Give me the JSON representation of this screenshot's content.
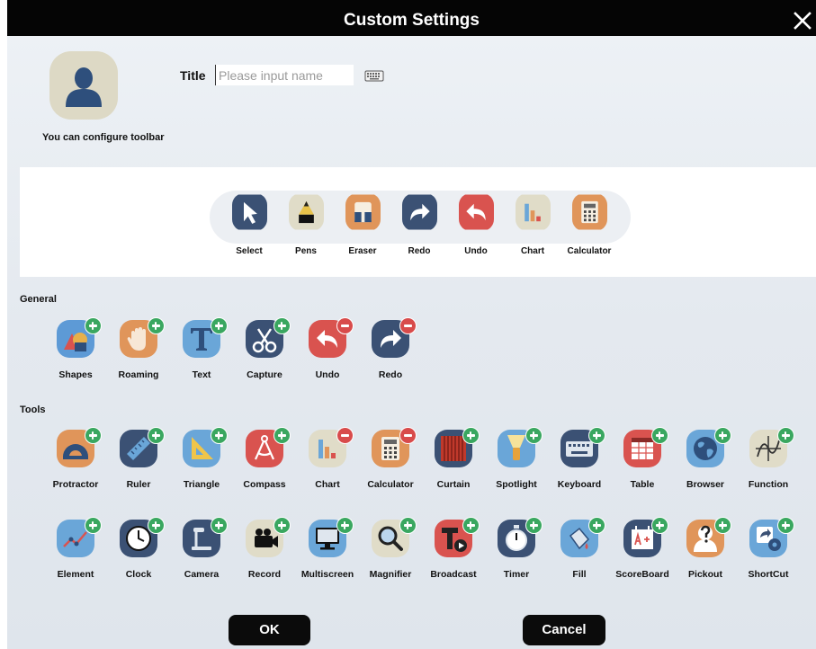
{
  "window": {
    "title": "Custom Settings"
  },
  "profile": {
    "configure_text": "You can configure toolbar"
  },
  "title_field": {
    "label": "Title",
    "placeholder": "Please input name",
    "value": ""
  },
  "preview_toolbar": [
    {
      "label": "Select",
      "icon": "cursor-arrow-icon",
      "color": "#3b5174"
    },
    {
      "label": "Pens",
      "icon": "pen-icon",
      "color": "#e0dcc8"
    },
    {
      "label": "Eraser",
      "icon": "eraser-icon",
      "color": "#e0955a"
    },
    {
      "label": "Redo",
      "icon": "redo-arrow-icon",
      "color": "#3b5174"
    },
    {
      "label": "Undo",
      "icon": "undo-arrow-icon",
      "color": "#d9534f"
    },
    {
      "label": "Chart",
      "icon": "bar-chart-icon",
      "color": "#e0dcc8"
    },
    {
      "label": "Calculator",
      "icon": "calculator-icon",
      "color": "#e0955a"
    }
  ],
  "sections": {
    "general": "General",
    "tools": "Tools"
  },
  "general_tools": [
    {
      "label": "Shapes",
      "icon": "shapes-icon",
      "color": "#5d9ad6",
      "badge": "add"
    },
    {
      "label": "Roaming",
      "icon": "hand-icon",
      "color": "#e0955a",
      "badge": "add"
    },
    {
      "label": "Text",
      "icon": "text-icon",
      "color": "#6aa6d8",
      "badge": "add"
    },
    {
      "label": "Capture",
      "icon": "scissors-icon",
      "color": "#3b5174",
      "badge": "add"
    },
    {
      "label": "Undo",
      "icon": "undo-arrow-icon",
      "color": "#d9534f",
      "badge": "remove"
    },
    {
      "label": "Redo",
      "icon": "redo-arrow-icon",
      "color": "#3b5174",
      "badge": "remove"
    }
  ],
  "tools_row1": [
    {
      "label": "Protractor",
      "icon": "protractor-icon",
      "color": "#e0955a",
      "badge": "add"
    },
    {
      "label": "Ruler",
      "icon": "ruler-icon",
      "color": "#3b5174",
      "badge": "add"
    },
    {
      "label": "Triangle",
      "icon": "triangle-ruler-icon",
      "color": "#6aa6d8",
      "badge": "add"
    },
    {
      "label": "Compass",
      "icon": "compass-icon",
      "color": "#d9534f",
      "badge": "add"
    },
    {
      "label": "Chart",
      "icon": "bar-chart-icon",
      "color": "#e0dcc8",
      "badge": "remove"
    },
    {
      "label": "Calculator",
      "icon": "calculator-icon",
      "color": "#e0955a",
      "badge": "remove"
    },
    {
      "label": "Curtain",
      "icon": "curtain-icon",
      "color": "#3b5174",
      "badge": "add"
    },
    {
      "label": "Spotlight",
      "icon": "spotlight-icon",
      "color": "#6aa6d8",
      "badge": "add"
    },
    {
      "label": "Keyboard",
      "icon": "keyboard-icon",
      "color": "#3b5174",
      "badge": "add"
    },
    {
      "label": "Table",
      "icon": "table-icon",
      "color": "#d9534f",
      "badge": "add"
    },
    {
      "label": "Browser",
      "icon": "globe-icon",
      "color": "#6aa6d8",
      "badge": "add"
    },
    {
      "label": "Function",
      "icon": "function-graph-icon",
      "color": "#e0dcc8",
      "badge": "add"
    }
  ],
  "tools_row2": [
    {
      "label": "Element",
      "icon": "element-chart-icon",
      "color": "#6aa6d8",
      "badge": "add"
    },
    {
      "label": "Clock",
      "icon": "clock-icon",
      "color": "#3b5174",
      "badge": "add"
    },
    {
      "label": "Camera",
      "icon": "document-camera-icon",
      "color": "#3b5174",
      "badge": "add"
    },
    {
      "label": "Record",
      "icon": "video-camera-icon",
      "color": "#e0dcc8",
      "badge": "add"
    },
    {
      "label": "Multiscreen",
      "icon": "monitor-icon",
      "color": "#6aa6d8",
      "badge": "add"
    },
    {
      "label": "Magnifier",
      "icon": "magnifier-icon",
      "color": "#e0dcc8",
      "badge": "add"
    },
    {
      "label": "Broadcast",
      "icon": "broadcast-icon",
      "color": "#d9534f",
      "badge": "add"
    },
    {
      "label": "Timer",
      "icon": "stopwatch-icon",
      "color": "#3b5174",
      "badge": "add"
    },
    {
      "label": "Fill",
      "icon": "paint-bucket-icon",
      "color": "#6aa6d8",
      "badge": "add"
    },
    {
      "label": "ScoreBoard",
      "icon": "scoreboard-icon",
      "color": "#3b5174",
      "badge": "add"
    },
    {
      "label": "Pickout",
      "icon": "question-person-icon",
      "color": "#e0955a",
      "badge": "add"
    },
    {
      "label": "ShortCut",
      "icon": "shortcut-gear-icon",
      "color": "#6aa6d8",
      "badge": "add"
    }
  ],
  "buttons": {
    "ok": "OK",
    "cancel": "Cancel"
  }
}
